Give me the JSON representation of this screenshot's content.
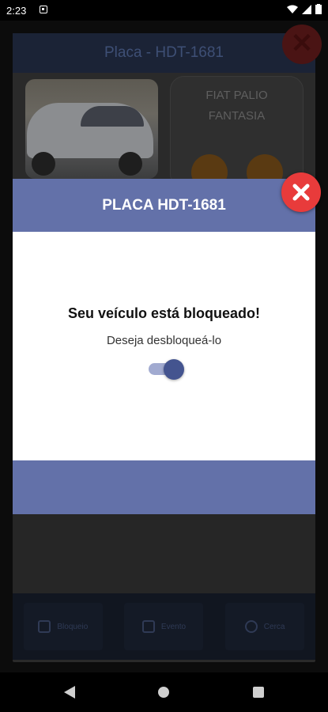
{
  "status_bar": {
    "time": "2:23"
  },
  "background": {
    "header_title": "Placa - HDT-1681",
    "car_model_line1": "FIAT PALIO",
    "car_model_line2": "FANTASIA",
    "nav_items": [
      {
        "label": "Bloqueio"
      },
      {
        "label": "Evento"
      },
      {
        "label": "Cerca"
      }
    ]
  },
  "modal": {
    "header_title": "PLACA HDT-1681",
    "title": "Seu veículo está bloqueado!",
    "subtitle": "Deseja desbloqueá-lo",
    "toggle_on": true
  },
  "colors": {
    "accent": "#6371a9",
    "toggle_thumb": "#44548f",
    "close": "#e83b3b"
  }
}
